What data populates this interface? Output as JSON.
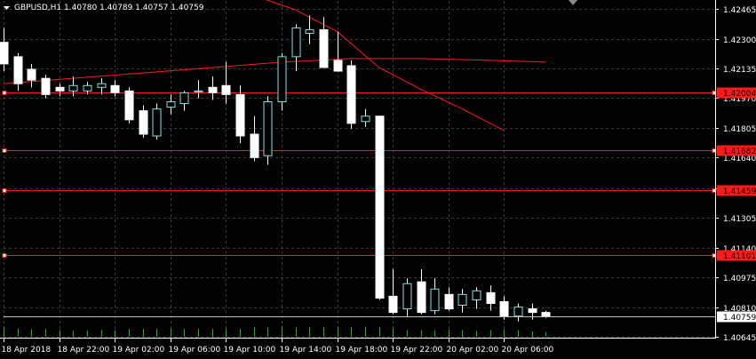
{
  "header": {
    "symbol": "GBPUSD,H1",
    "ohlc": "1.40780 1.40789 1.40757 1.40759",
    "title": "GBPUSD,H1  1.40780 1.40789 1.40757 1.40759"
  },
  "colors": {
    "background": "#000000",
    "grid": "#3a3a3a",
    "frame": "#ffffff",
    "bull_body_fill": "#000000",
    "bull_outline": "#7fe0e0",
    "bear_body": "#ffffff",
    "wick": "#ffffff",
    "ma_line": "#ff1a1a",
    "level_line": "#ff1a1a",
    "level_label_bg": "#ff1a1a",
    "volume": "#27b227",
    "bid_line": "#c0c0c0",
    "price_label_bg": "#ffffff",
    "price_label_text": "#000000"
  },
  "chart_data": {
    "type": "candlestick",
    "symbol": "GBPUSD",
    "timeframe": "H1",
    "ylim": [
      1.4064,
      1.4251
    ],
    "y_ticks": [
      "1.42465",
      "1.42300",
      "1.42135",
      "1.41970",
      "1.41805",
      "1.41640",
      "1.41470",
      "1.41305",
      "1.41140",
      "1.40975",
      "1.40810",
      "1.40645"
    ],
    "x_ticks": [
      "18 Apr 2018",
      "18 Apr 22:00",
      "19 Apr 02:00",
      "19 Apr 06:00",
      "19 Apr 10:00",
      "19 Apr 14:00",
      "19 Apr 18:00",
      "19 Apr 22:00",
      "20 Apr 02:00",
      "20 Apr 06:00"
    ],
    "x_tick_bar_index": [
      0,
      4,
      8,
      12,
      16,
      20,
      24,
      28,
      32,
      36
    ],
    "candles": [
      {
        "o": 1.4228,
        "h": 1.4236,
        "l": 1.4212,
        "c": 1.4216
      },
      {
        "o": 1.422,
        "h": 1.4222,
        "l": 1.4201,
        "c": 1.4205
      },
      {
        "o": 1.4213,
        "h": 1.4216,
        "l": 1.4203,
        "c": 1.4207
      },
      {
        "o": 1.4208,
        "h": 1.421,
        "l": 1.4197,
        "c": 1.4199
      },
      {
        "o": 1.4203,
        "h": 1.4205,
        "l": 1.4198,
        "c": 1.4201
      },
      {
        "o": 1.4201,
        "h": 1.4209,
        "l": 1.4198,
        "c": 1.4204
      },
      {
        "o": 1.4201,
        "h": 1.4206,
        "l": 1.4199,
        "c": 1.4204
      },
      {
        "o": 1.4203,
        "h": 1.4208,
        "l": 1.4199,
        "c": 1.4205
      },
      {
        "o": 1.4204,
        "h": 1.4207,
        "l": 1.4198,
        "c": 1.42
      },
      {
        "o": 1.4201,
        "h": 1.4203,
        "l": 1.4183,
        "c": 1.4185
      },
      {
        "o": 1.419,
        "h": 1.4193,
        "l": 1.4175,
        "c": 1.4177
      },
      {
        "o": 1.4176,
        "h": 1.4194,
        "l": 1.4174,
        "c": 1.4191
      },
      {
        "o": 1.4192,
        "h": 1.4199,
        "l": 1.4188,
        "c": 1.4195
      },
      {
        "o": 1.4194,
        "h": 1.4201,
        "l": 1.419,
        "c": 1.42
      },
      {
        "o": 1.4201,
        "h": 1.4207,
        "l": 1.4197,
        "c": 1.4201
      },
      {
        "o": 1.4203,
        "h": 1.4209,
        "l": 1.4196,
        "c": 1.42
      },
      {
        "o": 1.4204,
        "h": 1.4217,
        "l": 1.4194,
        "c": 1.4199
      },
      {
        "o": 1.4199,
        "h": 1.4204,
        "l": 1.4172,
        "c": 1.4176
      },
      {
        "o": 1.4177,
        "h": 1.4187,
        "l": 1.4162,
        "c": 1.4164
      },
      {
        "o": 1.4165,
        "h": 1.4198,
        "l": 1.416,
        "c": 1.4195
      },
      {
        "o": 1.4195,
        "h": 1.4222,
        "l": 1.419,
        "c": 1.422
      },
      {
        "o": 1.422,
        "h": 1.4238,
        "l": 1.4212,
        "c": 1.4236
      },
      {
        "o": 1.4233,
        "h": 1.4243,
        "l": 1.4227,
        "c": 1.4235
      },
      {
        "o": 1.4235,
        "h": 1.4242,
        "l": 1.4225,
        "c": 1.4214
      },
      {
        "o": 1.4218,
        "h": 1.4234,
        "l": 1.4213,
        "c": 1.4212
      },
      {
        "o": 1.4215,
        "h": 1.4218,
        "l": 1.418,
        "c": 1.4183
      },
      {
        "o": 1.4184,
        "h": 1.4191,
        "l": 1.4181,
        "c": 1.4187
      },
      {
        "o": 1.4187,
        "h": 1.4187,
        "l": 1.4085,
        "c": 1.4086
      },
      {
        "o": 1.4087,
        "h": 1.4102,
        "l": 1.4077,
        "c": 1.4078
      },
      {
        "o": 1.408,
        "h": 1.4097,
        "l": 1.4076,
        "c": 1.4094
      },
      {
        "o": 1.4095,
        "h": 1.4102,
        "l": 1.4077,
        "c": 1.4078
      },
      {
        "o": 1.4079,
        "h": 1.4097,
        "l": 1.4077,
        "c": 1.4091
      },
      {
        "o": 1.4088,
        "h": 1.4092,
        "l": 1.4079,
        "c": 1.408
      },
      {
        "o": 1.4082,
        "h": 1.4091,
        "l": 1.4078,
        "c": 1.4088
      },
      {
        "o": 1.4085,
        "h": 1.4092,
        "l": 1.408,
        "c": 1.409
      },
      {
        "o": 1.4089,
        "h": 1.4093,
        "l": 1.4079,
        "c": 1.4083
      },
      {
        "o": 1.4084,
        "h": 1.4087,
        "l": 1.4074,
        "c": 1.4076
      },
      {
        "o": 1.4076,
        "h": 1.4083,
        "l": 1.4073,
        "c": 1.4081
      },
      {
        "o": 1.408,
        "h": 1.4083,
        "l": 1.4074,
        "c": 1.4078
      },
      {
        "o": 1.4078,
        "h": 1.4079,
        "l": 1.4075,
        "c": 1.4076
      }
    ],
    "volume_scale_max": 100,
    "volumes": [
      35,
      30,
      28,
      29,
      25,
      22,
      24,
      26,
      25,
      30,
      30,
      30,
      30,
      30,
      30,
      30,
      30,
      30,
      35,
      35,
      40,
      35,
      35,
      35,
      35,
      35,
      38,
      35,
      30,
      25,
      25,
      25,
      28,
      25,
      22,
      25,
      28,
      25,
      20,
      18
    ],
    "ma_slow": [
      {
        "bar": 0,
        "price": 1.4205
      },
      {
        "bar": 5,
        "price": 1.4208
      },
      {
        "bar": 10,
        "price": 1.4211
      },
      {
        "bar": 15,
        "price": 1.4214
      },
      {
        "bar": 20,
        "price": 1.4217
      },
      {
        "bar": 25,
        "price": 1.4219
      },
      {
        "bar": 30,
        "price": 1.4219
      },
      {
        "bar": 35,
        "price": 1.4218
      },
      {
        "bar": 39,
        "price": 1.4217
      }
    ],
    "ma_fast": [
      {
        "bar": 16,
        "price": 1.4263
      },
      {
        "bar": 18,
        "price": 1.4254
      },
      {
        "bar": 21,
        "price": 1.4246
      },
      {
        "bar": 24,
        "price": 1.4234
      },
      {
        "bar": 27,
        "price": 1.4214
      },
      {
        "bar": 30,
        "price": 1.4202
      },
      {
        "bar": 33,
        "price": 1.4191
      },
      {
        "bar": 36,
        "price": 1.4179
      }
    ],
    "levels": [
      {
        "label": "1.42004",
        "price": 1.42004
      },
      {
        "label": "1.41682",
        "price": 1.41682
      },
      {
        "label": "1.41459",
        "price": 1.41459
      },
      {
        "label": "1.41101",
        "price": 1.41101
      }
    ],
    "current_price": {
      "label": "1.40759",
      "price": 1.40759
    }
  }
}
